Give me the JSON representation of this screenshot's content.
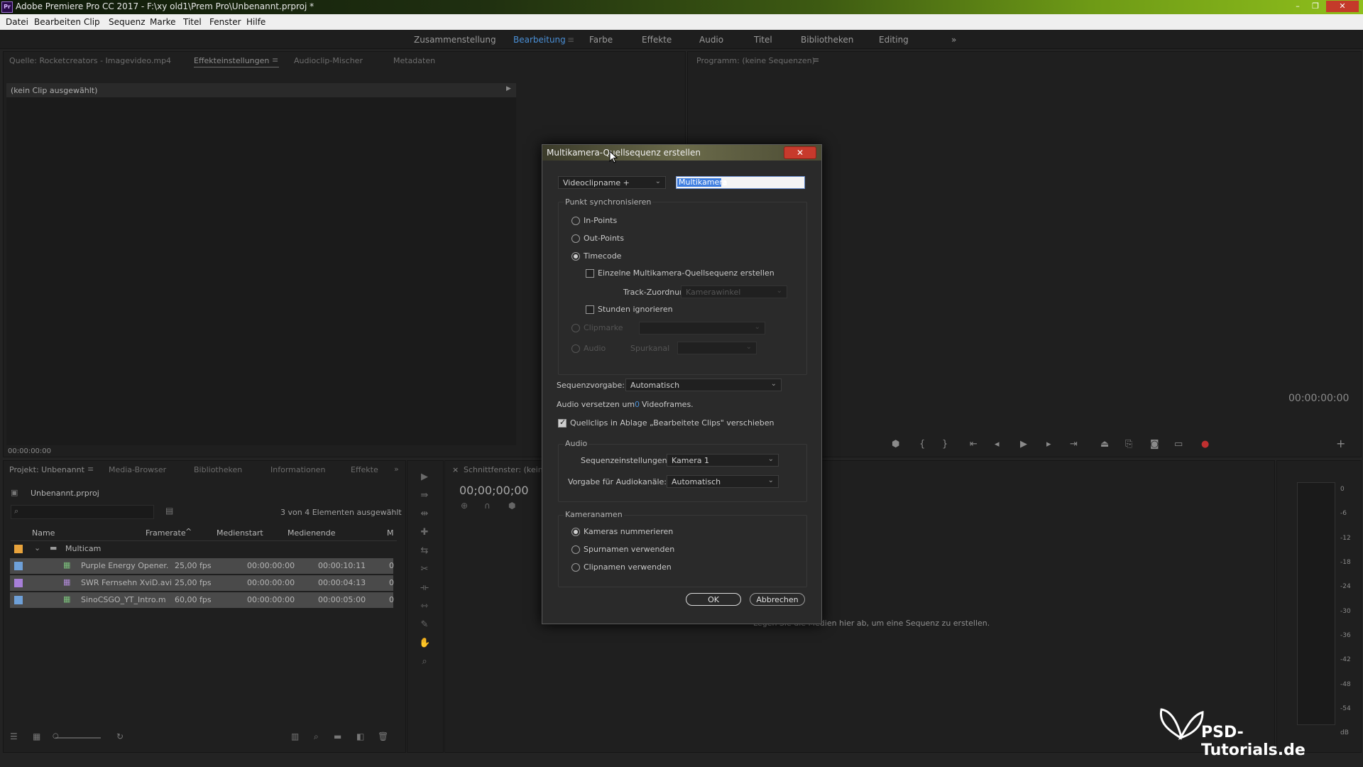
{
  "window": {
    "title": "Adobe Premiere Pro CC 2017 - F:\\xy old1\\Prem Pro\\Unbenannt.prproj *",
    "logo": "Pr",
    "controls": [
      "–",
      "❐",
      "✕"
    ]
  },
  "menu": [
    "Datei",
    "Bearbeiten",
    "Clip",
    "Sequenz",
    "Marke",
    "Titel",
    "Fenster",
    "Hilfe"
  ],
  "workspaces": {
    "items": [
      "Zusammenstellung",
      "Bearbeitung",
      "Farbe",
      "Effekte",
      "Audio",
      "Titel",
      "Bibliotheken",
      "Editing"
    ],
    "active": "Bearbeitung",
    "overflow": "»"
  },
  "source_panel": {
    "tabs": [
      "Quelle: Rocketcreators - Imagevideo.mp4",
      "Effekteinstellungen",
      "Audioclip-Mischer",
      "Metadaten"
    ],
    "active_tab": "Effekteinstellungen",
    "no_clip": "(kein Clip ausgewählt)",
    "timecode": "00:00:00:00"
  },
  "program_panel": {
    "tab": "Programm: (keine Sequenzen)",
    "timecode": "00:00:00:00"
  },
  "project_panel": {
    "tabs": [
      "Projekt: Unbenannt",
      "Media-Browser",
      "Bibliotheken",
      "Informationen",
      "Effekte"
    ],
    "project_name": "Unbenannt.prproj",
    "selection_info": "3 von 4 Elementen ausgewählt",
    "columns": [
      "Name",
      "Framerate",
      "Medienstart",
      "Medienende",
      "M"
    ],
    "folder": {
      "name": "Multicam",
      "color": "#e8a33c"
    },
    "rows": [
      {
        "name": "Purple Energy Opener.",
        "framerate": "25,00 fps",
        "start": "00:00:00:00",
        "end": "00:00:10:11",
        "m": "0",
        "color": "#6ea0d8"
      },
      {
        "name": "SWR Fernsehn XviD.avi",
        "framerate": "25,00 fps",
        "start": "00:00:00:00",
        "end": "00:00:04:13",
        "m": "0",
        "color": "#a77fd8"
      },
      {
        "name": "SinoCSGO_YT_Intro.m",
        "framerate": "60,00 fps",
        "start": "00:00:00:00",
        "end": "00:00:05:00",
        "m": "0",
        "color": "#6ea0d8"
      }
    ]
  },
  "timeline": {
    "tab": "Schnittfenster: (keine",
    "timecode": "00;00;00;00",
    "hint": "Legen Sie die Medien hier ab, um eine Sequenz zu erstellen."
  },
  "meter": {
    "labels": [
      "0",
      "-6",
      "-12",
      "-18",
      "-24",
      "-30",
      "-36",
      "-42",
      "-48",
      "-54",
      "dB"
    ]
  },
  "dialog": {
    "title": "Multikamera-Quellsequenz erstellen",
    "name_mode": "Videoclipname +",
    "name_value": "Multikamera",
    "sync": {
      "title": "Punkt synchronisieren",
      "in_points": "In-Points",
      "out_points": "Out-Points",
      "timecode": "Timecode",
      "single_seq": "Einzelne Multikamera-Quellsequenz erstellen",
      "track_map_label": "Track-Zuordnungen:",
      "track_map_value": "Kamerawinkel",
      "ignore_hours": "Stunden ignorieren",
      "clip_marker": "Clipmarke",
      "audio": "Audio",
      "track_channel": "Spurkanal"
    },
    "seq_preset_label": "Sequenzvorgabe:",
    "seq_preset_value": "Automatisch",
    "audio_offset_prefix": "Audio versetzen um",
    "audio_offset_value": "0",
    "audio_offset_suffix": "Videoframes.",
    "move_clips": "Quellclips in Ablage „Bearbeitete Clips\" verschieben",
    "audio_group": {
      "title": "Audio",
      "seq_settings_label": "Sequenzeinstellungen:",
      "seq_settings_value": "Kamera 1",
      "channel_preset_label": "Vorgabe für Audiokanäle:",
      "channel_preset_value": "Automatisch"
    },
    "camera_names": {
      "title": "Kameranamen",
      "enumerate": "Kameras nummerieren",
      "track_names": "Spurnamen verwenden",
      "clip_names": "Clipnamen verwenden"
    },
    "ok": "OK",
    "cancel": "Abbrechen"
  },
  "watermark": "PSD-Tutorials.de"
}
